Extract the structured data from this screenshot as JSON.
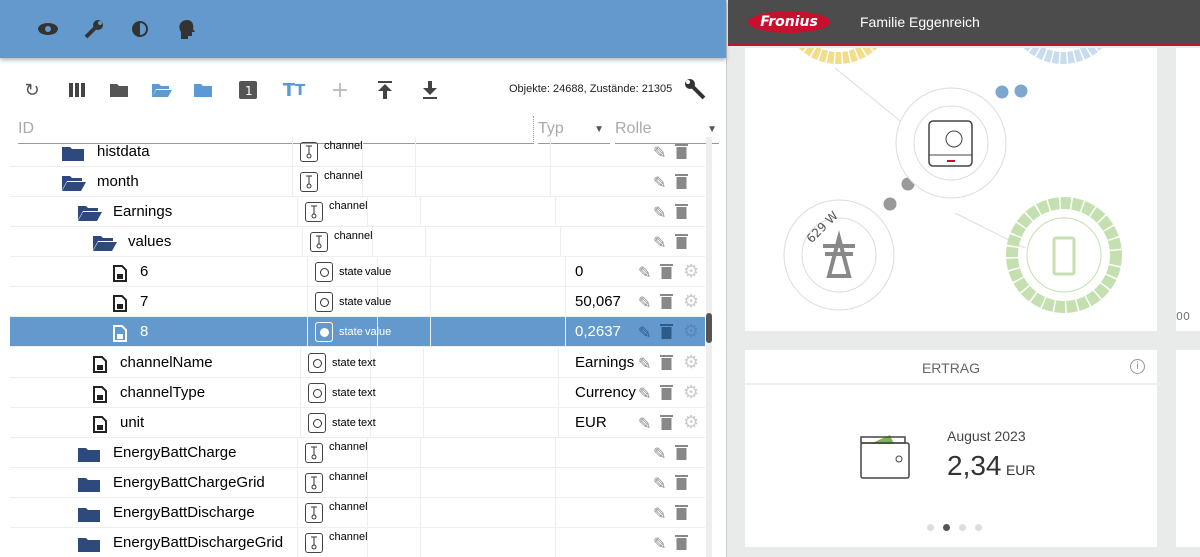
{
  "topbar": {
    "icons": [
      "eye-icon",
      "wrench-icon",
      "brightness-icon",
      "head-icon"
    ]
  },
  "toolbar": {
    "icons": [
      "refresh-icon",
      "columns-icon",
      "folder-closed-icon",
      "folder-open-icon",
      "folder-icon",
      "number-one-icon",
      "text-size-icon",
      "plus-icon",
      "upload-icon",
      "download-icon"
    ],
    "counts": "Objekte: 24688, Zustände: 21305"
  },
  "filters": {
    "id": "ID",
    "type": "Typ",
    "role": "Rolle"
  },
  "rows": [
    {
      "name": "histdata",
      "kind": "folder",
      "level": 1,
      "type": "channel"
    },
    {
      "name": "month",
      "kind": "folder-open",
      "level": 1,
      "type": "channel"
    },
    {
      "name": "Earnings",
      "kind": "folder-open",
      "level": 2,
      "type": "channel"
    },
    {
      "name": "values",
      "kind": "folder-open",
      "level": 3,
      "type": "channel"
    },
    {
      "name": "6",
      "kind": "file",
      "level": 4,
      "type": "state",
      "role": "value",
      "value": "0"
    },
    {
      "name": "7",
      "kind": "file",
      "level": 4,
      "type": "state",
      "role": "value",
      "value": "50,067"
    },
    {
      "name": "8",
      "kind": "file",
      "level": 4,
      "type": "state",
      "role": "value",
      "value": "0,2637",
      "selected": true
    },
    {
      "name": "channelName",
      "kind": "file",
      "level": 3,
      "type": "state",
      "role": "text",
      "value": "Earnings"
    },
    {
      "name": "channelType",
      "kind": "file",
      "level": 3,
      "type": "state",
      "role": "text",
      "value": "Currency"
    },
    {
      "name": "unit",
      "kind": "file",
      "level": 3,
      "type": "state",
      "role": "text",
      "value": "EUR"
    },
    {
      "name": "EnergyBattCharge",
      "kind": "folder",
      "level": 2,
      "type": "channel"
    },
    {
      "name": "EnergyBattChargeGrid",
      "kind": "folder",
      "level": 2,
      "type": "channel"
    },
    {
      "name": "EnergyBattDischarge",
      "kind": "folder",
      "level": 2,
      "type": "channel"
    },
    {
      "name": "EnergyBattDischargeGrid",
      "kind": "folder",
      "level": 2,
      "type": "channel"
    }
  ],
  "fronius": {
    "logo": "Fronius",
    "title": "Familie Eggenreich",
    "grid_power": "629 W",
    "axis_fragment": "00",
    "card": {
      "title": "ERTRAG",
      "period": "August 2023",
      "amount": "2,34",
      "unit": "EUR",
      "page": 2,
      "pages": 4
    },
    "colors": {
      "brand": "#c8102e",
      "pv": "#f3dc8a",
      "load": "#c9dcee",
      "battery": "#c5e0b0",
      "grid": "#999999"
    }
  }
}
